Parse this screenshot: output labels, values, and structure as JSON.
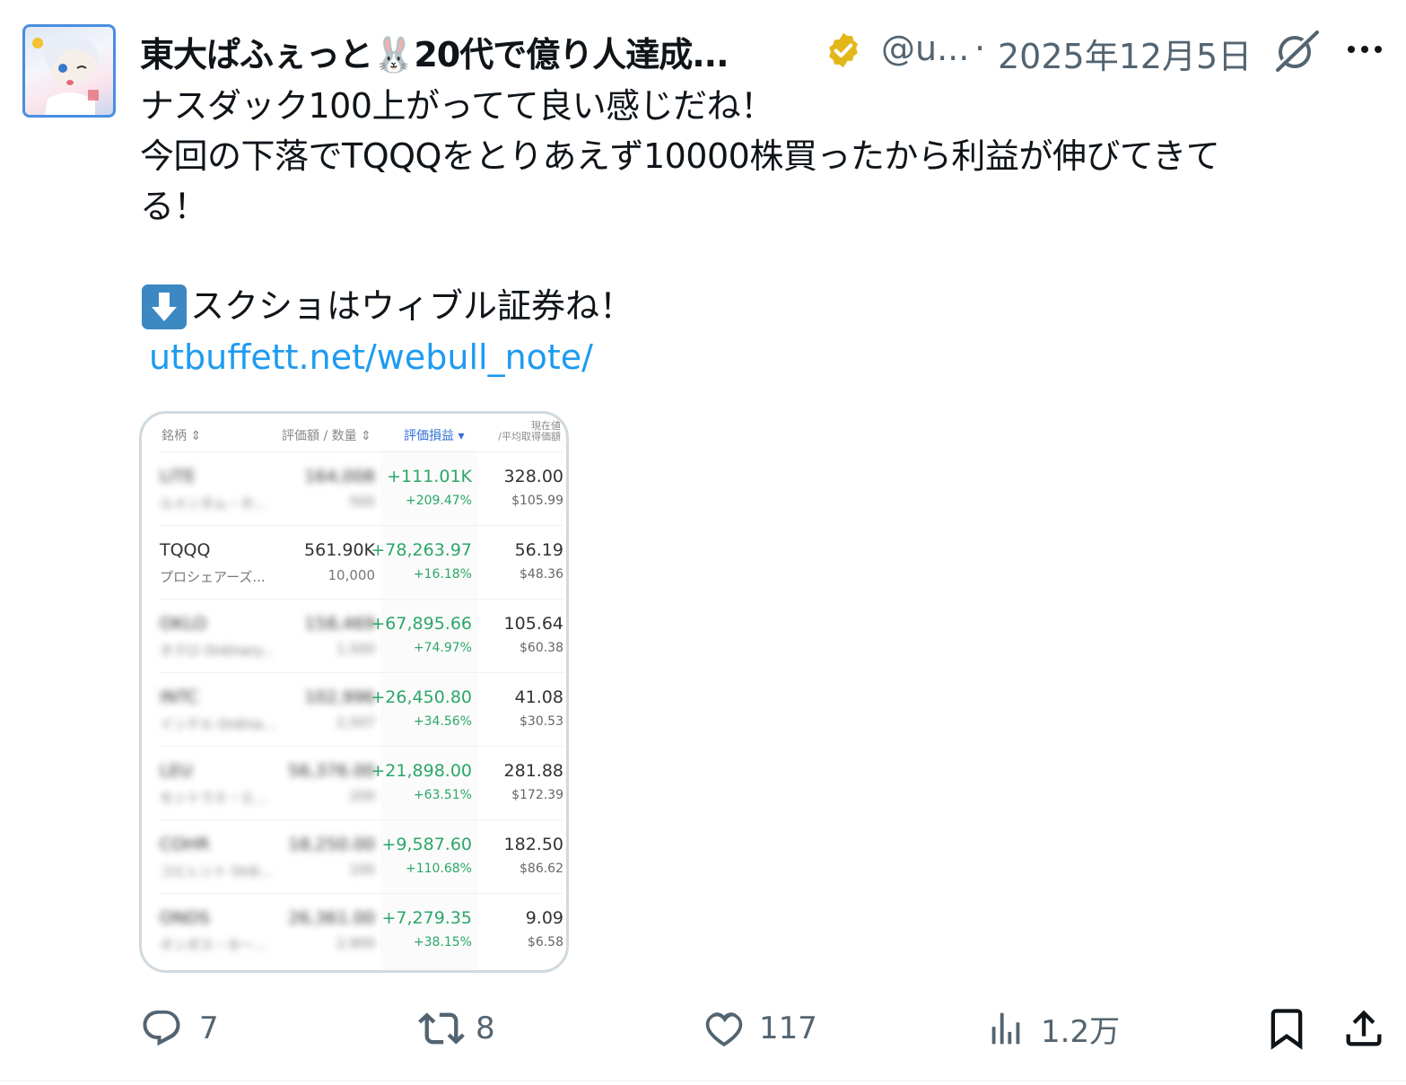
{
  "author": {
    "display_name": "東大ぱふぇっと🐰20代で億り人達成...",
    "handle": "@u...",
    "separator": "·",
    "date": "2025年12月5日"
  },
  "post": {
    "line1": "ナスダック100上がってて良い感じだね！",
    "line2": "今回の下落でTQQQをとりあえず10000株買ったから利益が伸びてきて",
    "line3": "る！",
    "line5": "スクショはウィブル証券ね！",
    "link": "utbuffett.net/webull_note/"
  },
  "table": {
    "headers": {
      "symbol": "銘柄 ⇕",
      "market_value": "評価額 / 数量 ⇕",
      "pl": "評価損益 ▾",
      "price_top": "現在値",
      "price_bottom": "/平均取得価額"
    },
    "rows": [
      {
        "symbol": "LITE",
        "name": "ルメンタム・ホ...",
        "mv": "164,008",
        "qty": "500",
        "pl": "+111.01K",
        "plpct": "+209.47%",
        "price": "328.00",
        "avg": "$105.99",
        "blurred": true
      },
      {
        "symbol": "TQQQ",
        "name": "プロシェアーズ...",
        "mv": "561.90K",
        "qty": "10,000",
        "pl": "+78,263.97",
        "plpct": "+16.18%",
        "price": "56.19",
        "avg": "$48.36",
        "blurred": false
      },
      {
        "symbol": "OKLO",
        "name": "オクロ Ordinary...",
        "mv": "158,469",
        "qty": "1,500",
        "pl": "+67,895.66",
        "plpct": "+74.97%",
        "price": "105.64",
        "avg": "$60.38",
        "blurred": true
      },
      {
        "symbol": "INTC",
        "name": "インテル Ordina...",
        "mv": "102,996",
        "qty": "2,507",
        "pl": "+26,450.80",
        "plpct": "+34.56%",
        "price": "41.08",
        "avg": "$30.53",
        "blurred": true
      },
      {
        "symbol": "LEU",
        "name": "セントラス・エ...",
        "mv": "56,376.00",
        "qty": "200",
        "pl": "+21,898.00",
        "plpct": "+63.51%",
        "price": "281.88",
        "avg": "$172.39",
        "blurred": true
      },
      {
        "symbol": "COHR",
        "name": "コヒレント Ordi...",
        "mv": "18,250.00",
        "qty": "100",
        "pl": "+9,587.60",
        "plpct": "+110.68%",
        "price": "182.50",
        "avg": "$86.62",
        "blurred": true
      },
      {
        "symbol": "ONDS",
        "name": "オンダス・ホー...",
        "mv": "26,361.00",
        "qty": "2,900",
        "pl": "+7,279.35",
        "plpct": "+38.15%",
        "price": "9.09",
        "avg": "$6.58",
        "blurred": true
      }
    ]
  },
  "actions": {
    "replies": "7",
    "reposts": "8",
    "likes": "117",
    "views": "1.2万"
  },
  "colors": {
    "link": "#1d9bf0",
    "secondary_text": "#536471",
    "gain_green": "#2da66a",
    "verified_gold": "#e2b719"
  },
  "icons": [
    "verified-badge-icon",
    "grok-icon",
    "more-icon",
    "down-arrow-emoji-icon",
    "reply-icon",
    "repost-icon",
    "like-icon",
    "views-icon",
    "bookmark-icon",
    "share-icon"
  ]
}
